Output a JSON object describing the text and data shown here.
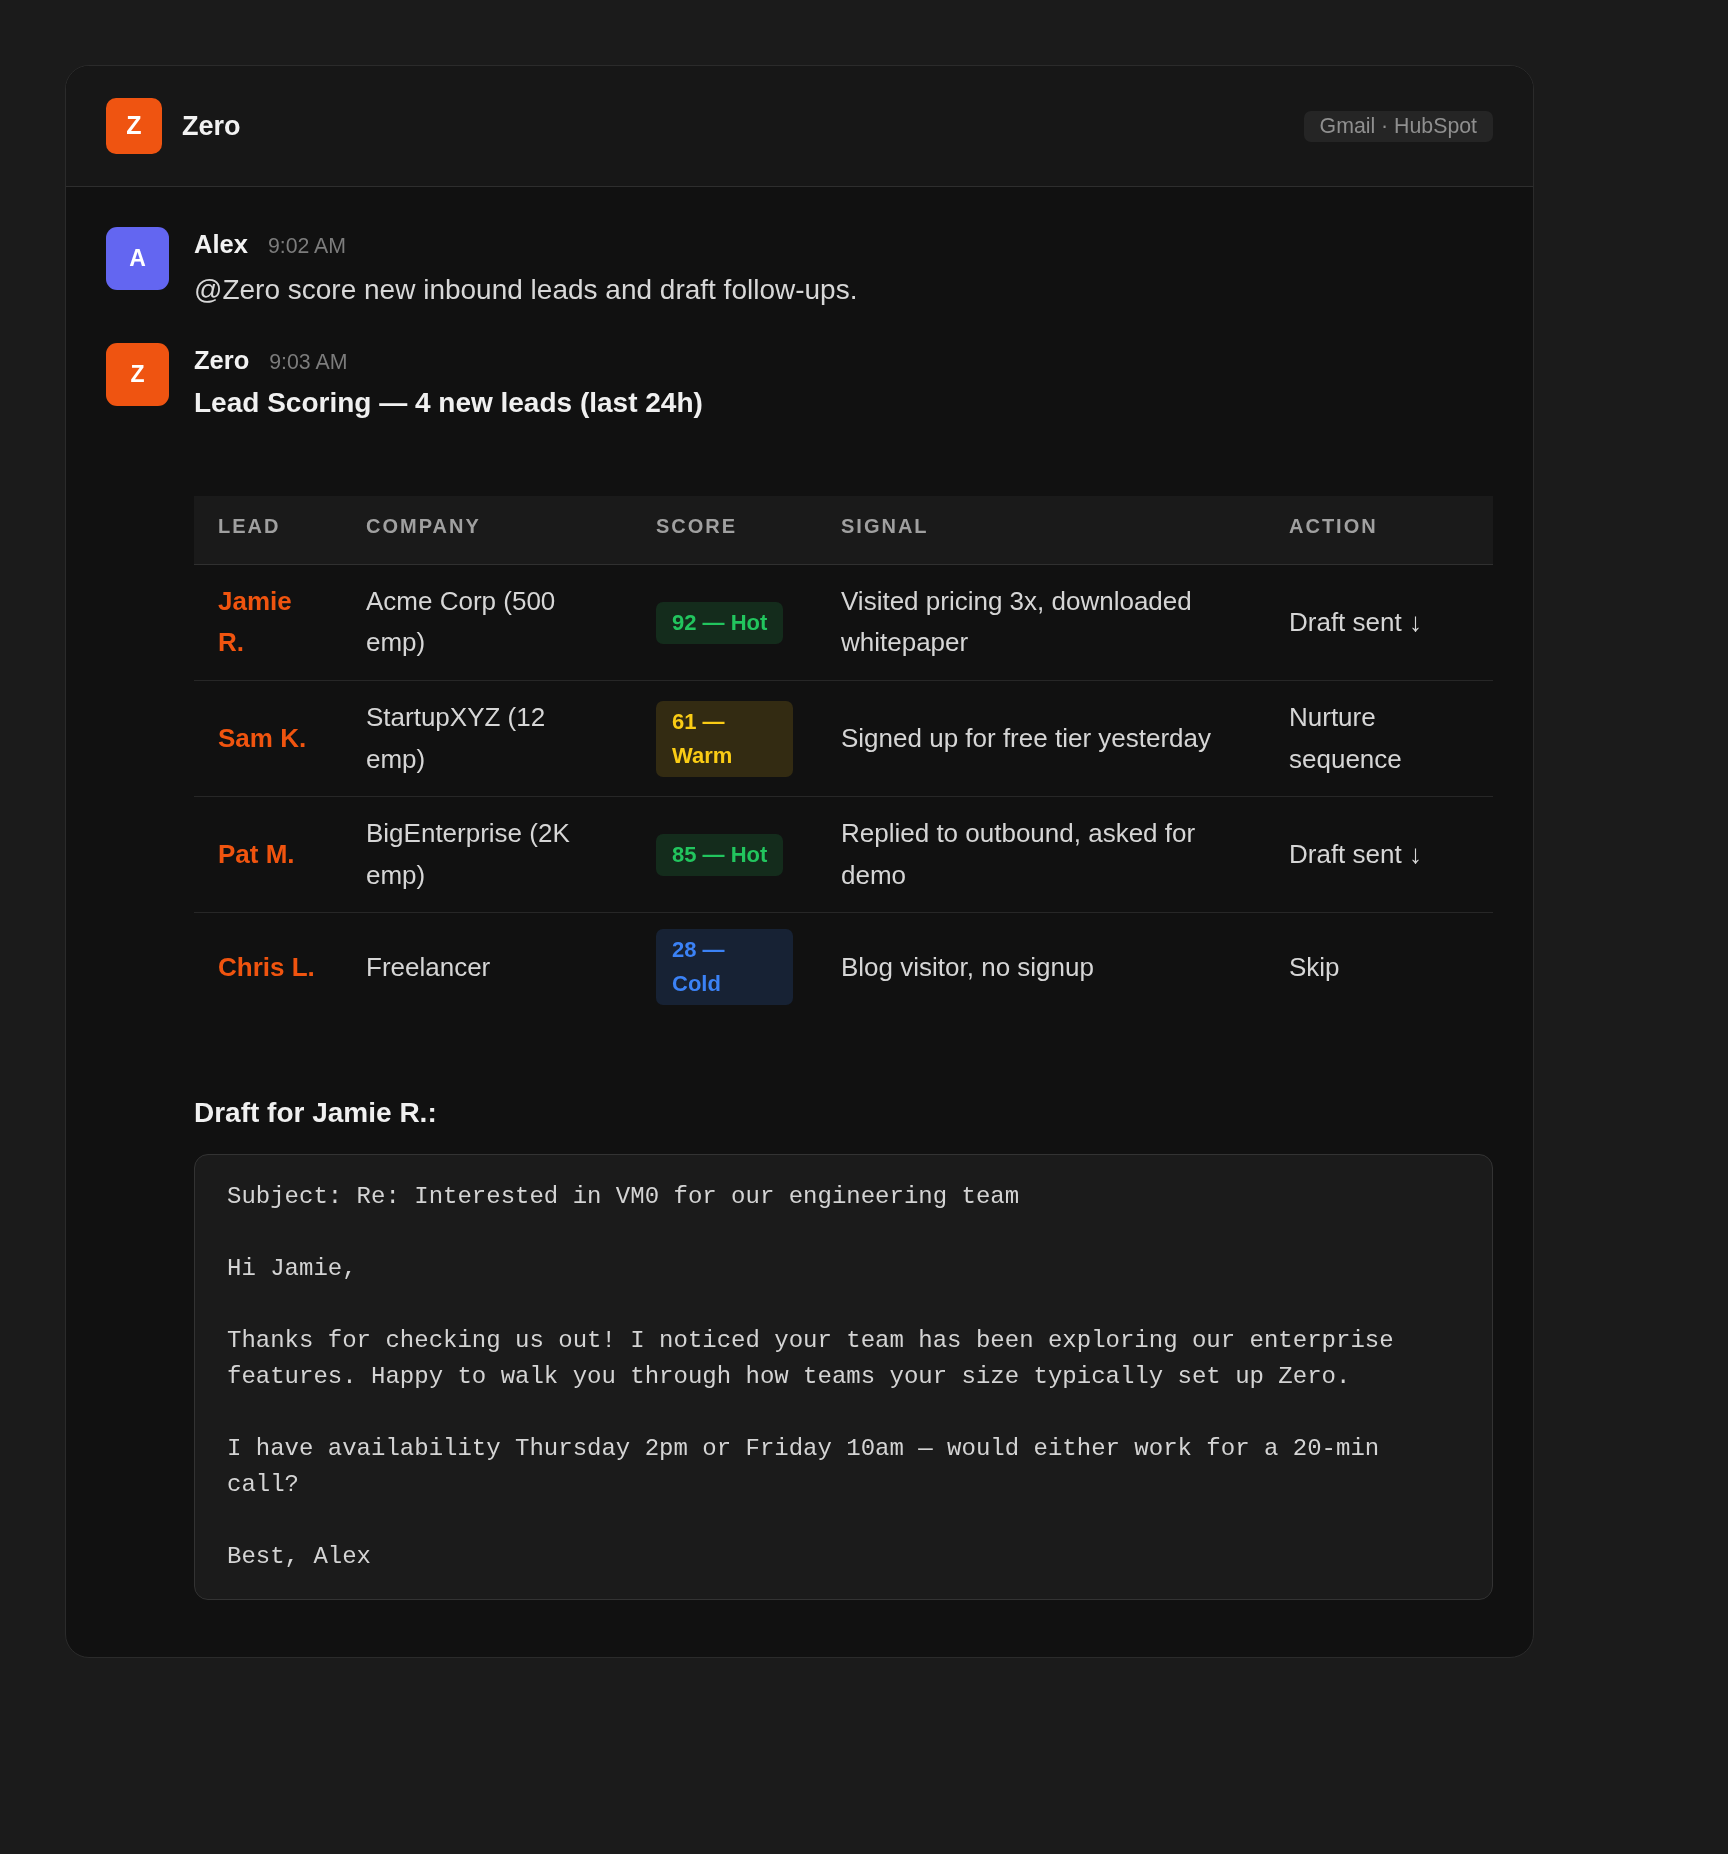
{
  "header": {
    "logo_letter": "Z",
    "app_name": "Zero",
    "integrations": "Gmail · HubSpot"
  },
  "messages": [
    {
      "kind": "text",
      "avatar_letter": "A",
      "color": "#6366f1",
      "author": "Alex",
      "time": "9:02 AM",
      "text": "@Zero score new inbound leads and draft follow-ups."
    },
    {
      "kind": "report",
      "avatar_letter": "Z",
      "color": "#ef5411",
      "author": "Zero",
      "time": "9:03 AM",
      "title": "Lead Scoring — 4 new leads (last 24h)",
      "table": {
        "columns": [
          "LEAD",
          "COMPANY",
          "SCORE",
          "SIGNAL",
          "ACTION"
        ],
        "rows": [
          {
            "lead": "Jamie R.",
            "company": "Acme Corp (500 emp)",
            "score": "92 — Hot",
            "kind": "hot",
            "signal": "Visited pricing 3x, downloaded whitepaper",
            "action": "Draft sent ↓"
          },
          {
            "lead": "Sam K.",
            "company": "StartupXYZ (12 emp)",
            "score": "61 — Warm",
            "kind": "warm",
            "signal": "Signed up for free tier yesterday",
            "action": "Nurture sequence"
          },
          {
            "lead": "Pat M.",
            "company": "BigEnterprise (2K emp)",
            "score": "85 — Hot",
            "kind": "hot",
            "signal": "Replied to outbound, asked for demo",
            "action": "Draft sent ↓"
          },
          {
            "lead": "Chris L.",
            "company": "Freelancer",
            "score": "28 — Cold",
            "kind": "cold",
            "signal": "Blog visitor, no signup",
            "action": "Skip"
          }
        ]
      },
      "draft": {
        "heading": "Draft for Jamie R.:",
        "paragraphs": [
          "Subject: Re: Interested in VM0 for our engineering team",
          "Hi Jamie,",
          "Thanks for checking us out! I noticed your team has been exploring our enterprise features. Happy to walk you through how teams your size typically set up Zero.",
          "I have availability Thursday 2pm or Friday 10am — would either work for a 20-min call?",
          "Best, Alex"
        ]
      }
    }
  ]
}
